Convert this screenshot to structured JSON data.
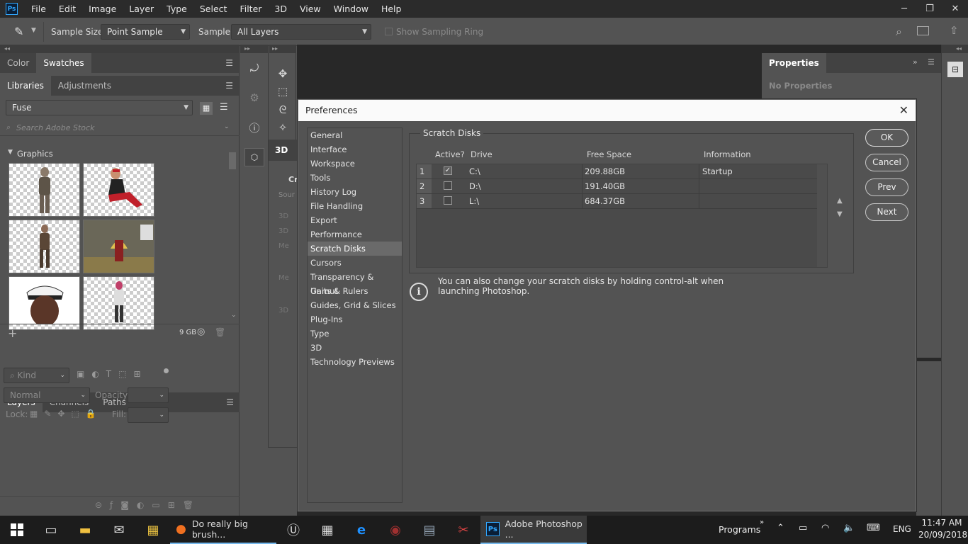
{
  "menubar": {
    "logo": "Ps",
    "items": [
      "File",
      "Edit",
      "Image",
      "Layer",
      "Type",
      "Select",
      "Filter",
      "3D",
      "View",
      "Window",
      "Help"
    ]
  },
  "options": {
    "sample_size_label": "Sample Size:",
    "sample_size_value": "Point Sample",
    "sample_label": "Sample:",
    "sample_value": "All Layers",
    "sampling_ring": "Show Sampling Ring"
  },
  "left_panels": {
    "color_tabs": [
      "Color",
      "Swatches"
    ],
    "library_tabs": [
      "Libraries",
      "Adjustments"
    ],
    "library_name": "Fuse",
    "search_placeholder": "Search Adobe Stock",
    "graphics_header": "Graphics",
    "storage": "9 GB",
    "layer_tabs": [
      "Layers",
      "Channels",
      "Paths"
    ],
    "kind_label": "Kind",
    "blend_mode": "Normal",
    "opacity_label": "Opacity:",
    "lock_label": "Lock:",
    "fill_label": "Fill:"
  },
  "middle_panel": {
    "tab_3d": "3D",
    "partial_labels": [
      "Cr",
      "Sour",
      "3D",
      "3D",
      "Me",
      "Me",
      "3D"
    ]
  },
  "right_panel": {
    "tab": "Properties",
    "empty": "No Properties"
  },
  "dialog": {
    "title": "Preferences",
    "nav": [
      "General",
      "Interface",
      "Workspace",
      "Tools",
      "History Log",
      "File Handling",
      "Export",
      "Performance",
      "Scratch Disks",
      "Cursors",
      "Transparency & Gamut",
      "Units & Rulers",
      "Guides, Grid & Slices",
      "Plug-Ins",
      "Type",
      "3D",
      "Technology Previews"
    ],
    "selected_nav": "Scratch Disks",
    "group_title": "Scratch Disks",
    "columns": [
      "Active?",
      "Drive",
      "Free Space",
      "Information"
    ],
    "rows": [
      {
        "num": "1",
        "active": true,
        "drive": "C:\\",
        "free": "209.88GB",
        "info": "Startup"
      },
      {
        "num": "2",
        "active": false,
        "drive": "D:\\",
        "free": "191.40GB",
        "info": ""
      },
      {
        "num": "3",
        "active": false,
        "drive": "L:\\",
        "free": "684.37GB",
        "info": ""
      }
    ],
    "info_text": "You can also change your scratch disks by holding control-alt when launching Photoshop.",
    "buttons": {
      "ok": "OK",
      "cancel": "Cancel",
      "prev": "Prev",
      "next": "Next"
    }
  },
  "taskbar": {
    "firefox_title": "Do really big brush...",
    "photoshop_title": "Adobe Photoshop ...",
    "programs": "Programs",
    "lang": "ENG",
    "time": "11:47 AM",
    "date": "20/09/2018"
  }
}
